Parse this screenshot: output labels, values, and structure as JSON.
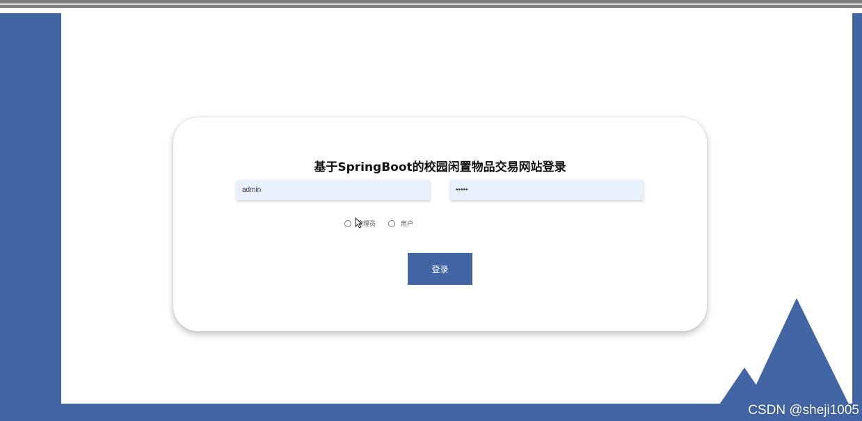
{
  "page": {
    "title": "基于SpringBoot的校园闲置物品交易网站登录",
    "username_value": "admin",
    "password_value": "•••••",
    "roles": [
      {
        "label": "管理员",
        "selected": false
      },
      {
        "label": "用户",
        "selected": false
      }
    ],
    "login_label": "登录"
  },
  "watermark": "CSDN @sheji1005",
  "colors": {
    "brand": "#4265a3",
    "field_bg": "#e8f0fb",
    "card_bg": "#ffffff"
  }
}
